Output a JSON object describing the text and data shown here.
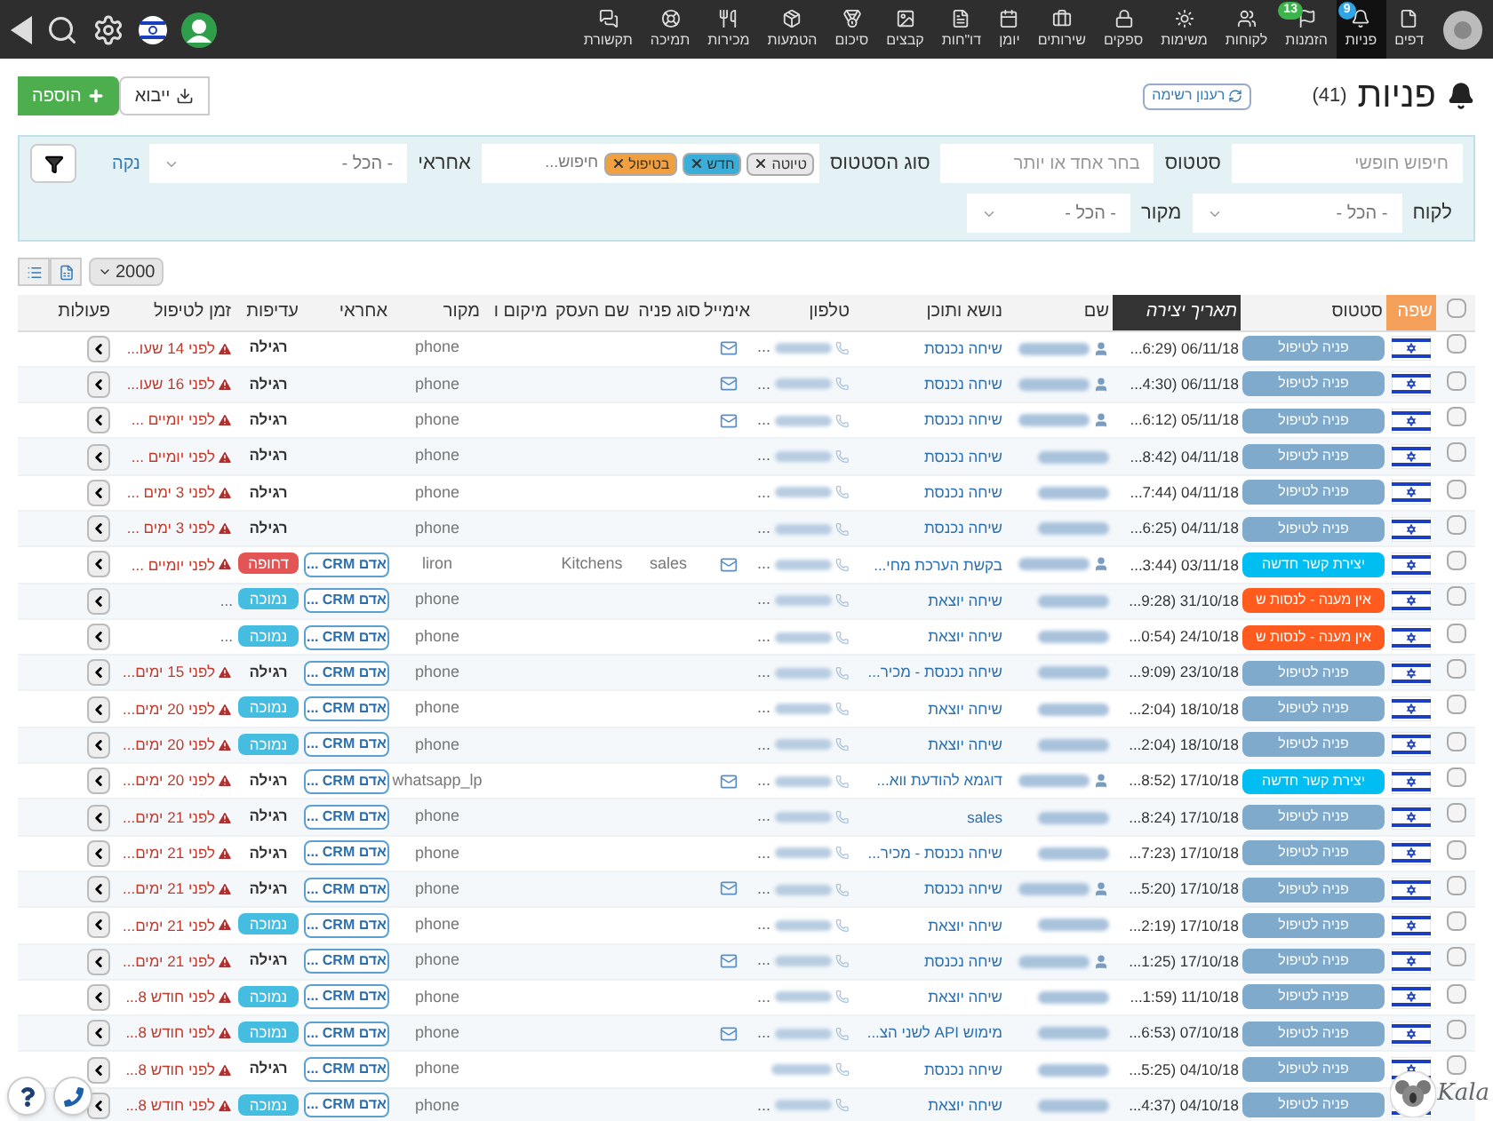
{
  "nav": {
    "items": [
      {
        "label": "דפים",
        "selected": false
      },
      {
        "label": "פניות",
        "selected": true,
        "badge": {
          "text": "9",
          "color": "#2fa4e7"
        }
      },
      {
        "label": "הזמנות",
        "selected": false,
        "badge": {
          "text": "13",
          "color": "#3cb44b"
        }
      },
      {
        "label": "לקוחות",
        "selected": false
      },
      {
        "label": "משימות",
        "selected": false
      },
      {
        "label": "ספקים",
        "selected": false
      },
      {
        "label": "שירותים",
        "selected": false
      },
      {
        "label": "יומן",
        "selected": false
      },
      {
        "label": "דו\"חות",
        "selected": false
      },
      {
        "label": "קבצים",
        "selected": false
      },
      {
        "label": "סיכום",
        "selected": false
      },
      {
        "label": "הטמעות",
        "selected": false
      },
      {
        "label": "מכירות",
        "selected": false
      },
      {
        "label": "תמיכה",
        "selected": false
      },
      {
        "label": "תקשורת",
        "selected": false
      }
    ]
  },
  "page": {
    "title": "פניות",
    "count": "(41)",
    "refresh": "רענון רשימה",
    "add": "הוספה",
    "import": "ייבוא"
  },
  "filters": {
    "free_search": {
      "placeholder": "חיפוש חופשי"
    },
    "status": {
      "label": "סטטוס",
      "placeholder": "בחר אחד או יותר"
    },
    "status_type": {
      "label": "סוג הסטטוס",
      "placeholder": "חיפוש...",
      "tags": [
        {
          "label": "טיוטה",
          "color": "#e8e8e8"
        },
        {
          "label": "חדש",
          "color": "#3aaed8"
        },
        {
          "label": "בטיפול",
          "color": "#f0a040"
        }
      ]
    },
    "assignee": {
      "label": "אחראי",
      "value": "- הכל -"
    },
    "clear": "נקה",
    "customer": {
      "label": "לקוח",
      "value": "- הכל -"
    },
    "source": {
      "label": "מקור",
      "value": "- הכל -"
    }
  },
  "page_size": "2000",
  "table": {
    "columns": [
      {
        "kind": "checkbox",
        "checked": false
      },
      {
        "kind": "accent",
        "label": "שפה"
      },
      {
        "kind": "plain",
        "label": "סטטוס"
      },
      {
        "kind": "sorted",
        "label": "תאריך יצירה"
      },
      {
        "kind": "plain",
        "label": "שם"
      },
      {
        "kind": "plain",
        "label": "נושא ותוכן"
      },
      {
        "kind": "plain",
        "label": "טלפון"
      },
      {
        "kind": "plain",
        "label": "אימייל"
      },
      {
        "kind": "plain",
        "label": "סוג פניה"
      },
      {
        "kind": "plain",
        "label": "שם העסק"
      },
      {
        "kind": "plain",
        "label": "מיקום ו"
      },
      {
        "kind": "plain",
        "label": "מקור"
      },
      {
        "kind": "plain",
        "label": "אחראי"
      },
      {
        "kind": "plain",
        "label": "עדיפות"
      },
      {
        "kind": "plain",
        "label": "זמן לטיפול"
      },
      {
        "kind": "plain",
        "label": "פעולות"
      }
    ],
    "rows": [
      {
        "checked": false,
        "status": {
          "label": "פניה לטיפול",
          "color": "#7faacb"
        },
        "date": "...6:29) 06/11/18",
        "contact_icon": true,
        "subject": "שיחה נכנסת",
        "phone": "...",
        "has_email": true,
        "source": "phone",
        "priority": {
          "label": "רגילה",
          "kind": "normal"
        },
        "overdue": true,
        "time": "לפני 14 שעו..."
      },
      {
        "checked": false,
        "status": {
          "label": "פניה לטיפול",
          "color": "#7faacb"
        },
        "date": "...4:30) 06/11/18",
        "contact_icon": true,
        "subject": "שיחה נכנסת",
        "phone": "...",
        "has_email": true,
        "source": "phone",
        "priority": {
          "label": "רגילה",
          "kind": "normal"
        },
        "overdue": true,
        "time": "לפני 16 שעו..."
      },
      {
        "checked": false,
        "status": {
          "label": "פניה לטיפול",
          "color": "#7faacb"
        },
        "date": "...6:12) 05/11/18",
        "contact_icon": true,
        "subject": "שיחה נכנסת",
        "phone": "...",
        "has_email": true,
        "source": "phone",
        "priority": {
          "label": "רגילה",
          "kind": "normal"
        },
        "overdue": true,
        "time": "לפני יומיים ..."
      },
      {
        "checked": false,
        "status": {
          "label": "פניה לטיפול",
          "color": "#7faacb"
        },
        "date": "...8:42) 04/11/18",
        "contact_icon": false,
        "subject": "שיחה נכנסת",
        "phone": "...",
        "has_email": false,
        "source": "phone",
        "priority": {
          "label": "רגילה",
          "kind": "normal"
        },
        "overdue": true,
        "time": "לפני יומיים ..."
      },
      {
        "checked": false,
        "status": {
          "label": "פניה לטיפול",
          "color": "#7faacb"
        },
        "date": "...7:44) 04/11/18",
        "contact_icon": false,
        "subject": "שיחה נכנסת",
        "phone": "...",
        "has_email": false,
        "source": "phone",
        "priority": {
          "label": "רגילה",
          "kind": "normal"
        },
        "overdue": true,
        "time": "לפני 3 ימים ..."
      },
      {
        "checked": false,
        "status": {
          "label": "פניה לטיפול",
          "color": "#7faacb"
        },
        "date": "...6:25) 04/11/18",
        "contact_icon": false,
        "subject": "שיחה נכנסת",
        "phone": "...",
        "has_email": false,
        "source": "phone",
        "priority": {
          "label": "רגילה",
          "kind": "normal"
        },
        "overdue": true,
        "time": "לפני 3 ימים ..."
      },
      {
        "checked": false,
        "status": {
          "label": "יצירת קשר חדשה",
          "color": "#00bdf2"
        },
        "date": "...3:44) 03/11/18",
        "contact_icon": true,
        "subject": "בקשת הערכת מחי...",
        "phone": "...",
        "has_email": true,
        "inquiry_type": "sales",
        "business": "Kitchens",
        "source": "liron",
        "assignee": "אדם CRM ...",
        "priority": {
          "label": "דחופה",
          "kind": "urgent"
        },
        "overdue": true,
        "time": "לפני יומיים ..."
      },
      {
        "checked": false,
        "status": {
          "label": "אין מענה - לנסות ש",
          "color": "#ff5b1e"
        },
        "date": "...9:28) 31/10/18",
        "contact_icon": false,
        "subject": "שיחה יוצאת",
        "phone": "...",
        "has_email": false,
        "source": "phone",
        "assignee": "אדם CRM ...",
        "priority": {
          "label": "נמוכה",
          "kind": "low"
        },
        "overdue": false,
        "time": "..."
      },
      {
        "checked": false,
        "status": {
          "label": "אין מענה - לנסות ש",
          "color": "#ff5b1e"
        },
        "date": "...0:54) 24/10/18",
        "contact_icon": false,
        "subject": "שיחה יוצאת",
        "phone": "...",
        "has_email": false,
        "source": "phone",
        "assignee": "אדם CRM ...",
        "priority": {
          "label": "נמוכה",
          "kind": "low"
        },
        "overdue": false,
        "time": "..."
      },
      {
        "checked": false,
        "status": {
          "label": "פניה לטיפול",
          "color": "#7faacb"
        },
        "date": "...9:09) 23/10/18",
        "contact_icon": false,
        "subject": "שיחה נכנסת - מכיר...",
        "phone": "...",
        "has_email": false,
        "source": "phone",
        "assignee": "אדם CRM ...",
        "priority": {
          "label": "רגילה",
          "kind": "normal"
        },
        "overdue": true,
        "time": "לפני 15 ימים..."
      },
      {
        "checked": false,
        "status": {
          "label": "פניה לטיפול",
          "color": "#7faacb"
        },
        "date": "...2:04) 18/10/18",
        "contact_icon": false,
        "subject": "שיחה יוצאת",
        "phone": "...",
        "has_email": false,
        "source": "phone",
        "assignee": "אדם CRM ...",
        "priority": {
          "label": "נמוכה",
          "kind": "low"
        },
        "overdue": true,
        "time": "לפני 20 ימים..."
      },
      {
        "checked": false,
        "status": {
          "label": "פניה לטיפול",
          "color": "#7faacb"
        },
        "date": "...2:04) 18/10/18",
        "contact_icon": false,
        "subject": "שיחה יוצאת",
        "phone": "...",
        "has_email": false,
        "source": "phone",
        "assignee": "אדם CRM ...",
        "priority": {
          "label": "נמוכה",
          "kind": "low"
        },
        "overdue": true,
        "time": "לפני 20 ימים..."
      },
      {
        "checked": false,
        "status": {
          "label": "יצירת קשר חדשה",
          "color": "#00bdf2"
        },
        "date": "...8:52) 17/10/18",
        "contact_icon": true,
        "subject": "דוגמא להודעת ווא...",
        "phone": "...",
        "has_email": true,
        "source": "whatsapp_lp",
        "assignee": "אדם CRM ...",
        "priority": {
          "label": "רגילה",
          "kind": "normal"
        },
        "overdue": true,
        "time": "לפני 20 ימים..."
      },
      {
        "checked": false,
        "status": {
          "label": "פניה לטיפול",
          "color": "#7faacb"
        },
        "date": "...8:24) 17/10/18",
        "contact_icon": false,
        "subject": "sales",
        "phone": "...",
        "has_email": false,
        "source": "phone",
        "assignee": "אדם CRM ...",
        "priority": {
          "label": "רגילה",
          "kind": "normal"
        },
        "overdue": true,
        "time": "לפני 21 ימים..."
      },
      {
        "checked": false,
        "status": {
          "label": "פניה לטיפול",
          "color": "#7faacb"
        },
        "date": "...7:23) 17/10/18",
        "contact_icon": false,
        "subject": "שיחה נכנסת - מכיר...",
        "phone": "...",
        "has_email": false,
        "source": "phone",
        "assignee": "אדם CRM ...",
        "priority": {
          "label": "רגילה",
          "kind": "normal"
        },
        "overdue": true,
        "time": "לפני 21 ימים..."
      },
      {
        "checked": false,
        "status": {
          "label": "פניה לטיפול",
          "color": "#7faacb"
        },
        "date": "...5:20) 17/10/18",
        "contact_icon": true,
        "subject": "שיחה נכנסת",
        "phone": "...",
        "has_email": true,
        "source": "phone",
        "assignee": "אדם CRM ...",
        "priority": {
          "label": "רגילה",
          "kind": "normal"
        },
        "overdue": true,
        "time": "לפני 21 ימים..."
      },
      {
        "checked": false,
        "status": {
          "label": "פניה לטיפול",
          "color": "#7faacb"
        },
        "date": "...2:19) 17/10/18",
        "contact_icon": false,
        "subject": "שיחה יוצאת",
        "phone": "...",
        "has_email": false,
        "source": "phone",
        "assignee": "אדם CRM ...",
        "priority": {
          "label": "נמוכה",
          "kind": "low"
        },
        "overdue": true,
        "time": "לפני 21 ימים..."
      },
      {
        "checked": false,
        "status": {
          "label": "פניה לטיפול",
          "color": "#7faacb"
        },
        "date": "...1:25) 17/10/18",
        "contact_icon": true,
        "subject": "שיחה נכנסת",
        "phone": "...",
        "has_email": true,
        "source": "phone",
        "assignee": "אדם CRM ...",
        "priority": {
          "label": "רגילה",
          "kind": "normal"
        },
        "overdue": true,
        "time": "לפני 21 ימים..."
      },
      {
        "checked": false,
        "status": {
          "label": "פניה לטיפול",
          "color": "#7faacb"
        },
        "date": "...1:59) 11/10/18",
        "contact_icon": false,
        "subject": "שיחה יוצאת",
        "phone": "...",
        "has_email": false,
        "source": "phone",
        "assignee": "אדם CRM ...",
        "priority": {
          "label": "נמוכה",
          "kind": "low"
        },
        "overdue": true,
        "time": "לפני חודש 8..."
      },
      {
        "checked": false,
        "status": {
          "label": "פניה לטיפול",
          "color": "#7faacb"
        },
        "date": "...6:53) 07/10/18",
        "contact_icon": false,
        "subject": "מימוש API לשני הצ...",
        "phone": "...",
        "has_email": true,
        "source": "phone",
        "assignee": "אדם CRM ...",
        "priority": {
          "label": "נמוכה",
          "kind": "low"
        },
        "overdue": true,
        "time": "לפני חודש 8..."
      },
      {
        "checked": false,
        "status": {
          "label": "פניה לטיפול",
          "color": "#7faacb"
        },
        "date": "...5:25) 04/10/18",
        "contact_icon": false,
        "subject": "שיחה נכנסת",
        "has_email": false,
        "source": "phone",
        "assignee": "אדם CRM ...",
        "priority": {
          "label": "רגילה",
          "kind": "normal"
        },
        "overdue": true,
        "time": "לפני חודש 8..."
      },
      {
        "status": {
          "label": "פניה לטיפול",
          "color": "#7faacb"
        },
        "date": "...4:37) 04/10/18",
        "contact_icon": false,
        "subject": "שיחה יוצאת",
        "phone": "...",
        "has_email": false,
        "source": "phone",
        "assignee": "אדם CRM ...",
        "priority": {
          "label": "נמוכה",
          "kind": "low"
        },
        "overdue": true,
        "time": "לפני חודש 8..."
      }
    ]
  },
  "logo_text": "Kala"
}
